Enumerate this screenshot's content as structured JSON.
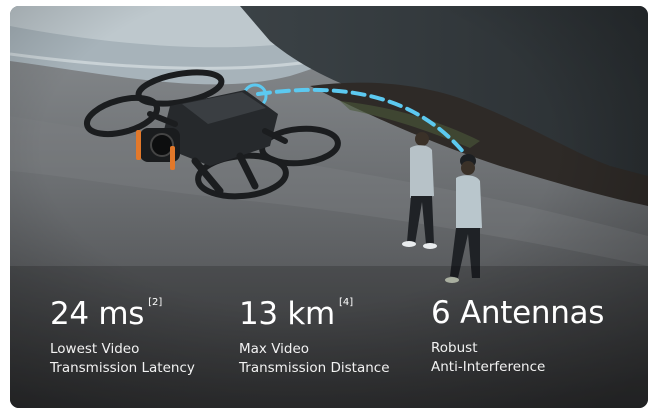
{
  "stats": [
    {
      "value": "24 ms",
      "footnote": "[2]",
      "label_line1": "Lowest Video",
      "label_line2": "Transmission Latency"
    },
    {
      "value": "13 km",
      "footnote": "[4]",
      "label_line1": "Max Video",
      "label_line2": "Transmission Distance"
    },
    {
      "value": "6 Antennas",
      "footnote": "",
      "label_line1": "Robust",
      "label_line2": "Anti-Interference"
    }
  ],
  "colors": {
    "signal_accent": "#5cc9f0",
    "text": "#ffffff"
  },
  "icons": {
    "drone": "drone-icon",
    "signal": "signal-link-icon"
  }
}
